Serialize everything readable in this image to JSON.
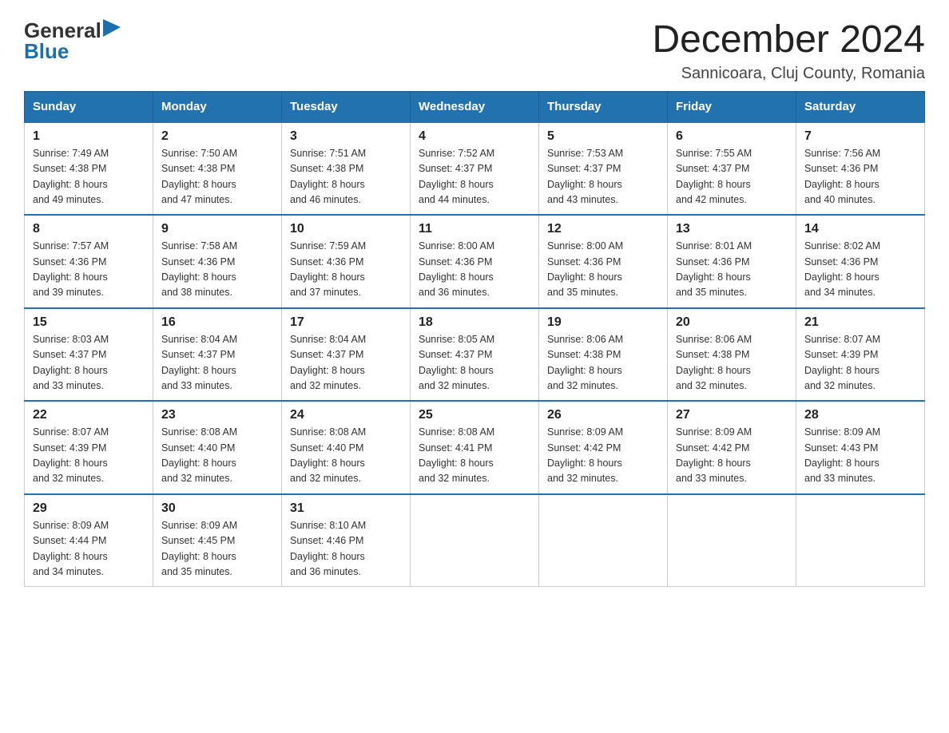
{
  "logo": {
    "general": "General",
    "blue": "Blue",
    "triangle": "▶"
  },
  "title": "December 2024",
  "location": "Sannicoara, Cluj County, Romania",
  "days_of_week": [
    "Sunday",
    "Monday",
    "Tuesday",
    "Wednesday",
    "Thursday",
    "Friday",
    "Saturday"
  ],
  "weeks": [
    [
      {
        "day": "1",
        "sunrise": "7:49 AM",
        "sunset": "4:38 PM",
        "daylight_hours": "8",
        "daylight_minutes": "49"
      },
      {
        "day": "2",
        "sunrise": "7:50 AM",
        "sunset": "4:38 PM",
        "daylight_hours": "8",
        "daylight_minutes": "47"
      },
      {
        "day": "3",
        "sunrise": "7:51 AM",
        "sunset": "4:38 PM",
        "daylight_hours": "8",
        "daylight_minutes": "46"
      },
      {
        "day": "4",
        "sunrise": "7:52 AM",
        "sunset": "4:37 PM",
        "daylight_hours": "8",
        "daylight_minutes": "44"
      },
      {
        "day": "5",
        "sunrise": "7:53 AM",
        "sunset": "4:37 PM",
        "daylight_hours": "8",
        "daylight_minutes": "43"
      },
      {
        "day": "6",
        "sunrise": "7:55 AM",
        "sunset": "4:37 PM",
        "daylight_hours": "8",
        "daylight_minutes": "42"
      },
      {
        "day": "7",
        "sunrise": "7:56 AM",
        "sunset": "4:36 PM",
        "daylight_hours": "8",
        "daylight_minutes": "40"
      }
    ],
    [
      {
        "day": "8",
        "sunrise": "7:57 AM",
        "sunset": "4:36 PM",
        "daylight_hours": "8",
        "daylight_minutes": "39"
      },
      {
        "day": "9",
        "sunrise": "7:58 AM",
        "sunset": "4:36 PM",
        "daylight_hours": "8",
        "daylight_minutes": "38"
      },
      {
        "day": "10",
        "sunrise": "7:59 AM",
        "sunset": "4:36 PM",
        "daylight_hours": "8",
        "daylight_minutes": "37"
      },
      {
        "day": "11",
        "sunrise": "8:00 AM",
        "sunset": "4:36 PM",
        "daylight_hours": "8",
        "daylight_minutes": "36"
      },
      {
        "day": "12",
        "sunrise": "8:00 AM",
        "sunset": "4:36 PM",
        "daylight_hours": "8",
        "daylight_minutes": "35"
      },
      {
        "day": "13",
        "sunrise": "8:01 AM",
        "sunset": "4:36 PM",
        "daylight_hours": "8",
        "daylight_minutes": "35"
      },
      {
        "day": "14",
        "sunrise": "8:02 AM",
        "sunset": "4:36 PM",
        "daylight_hours": "8",
        "daylight_minutes": "34"
      }
    ],
    [
      {
        "day": "15",
        "sunrise": "8:03 AM",
        "sunset": "4:37 PM",
        "daylight_hours": "8",
        "daylight_minutes": "33"
      },
      {
        "day": "16",
        "sunrise": "8:04 AM",
        "sunset": "4:37 PM",
        "daylight_hours": "8",
        "daylight_minutes": "33"
      },
      {
        "day": "17",
        "sunrise": "8:04 AM",
        "sunset": "4:37 PM",
        "daylight_hours": "8",
        "daylight_minutes": "32"
      },
      {
        "day": "18",
        "sunrise": "8:05 AM",
        "sunset": "4:37 PM",
        "daylight_hours": "8",
        "daylight_minutes": "32"
      },
      {
        "day": "19",
        "sunrise": "8:06 AM",
        "sunset": "4:38 PM",
        "daylight_hours": "8",
        "daylight_minutes": "32"
      },
      {
        "day": "20",
        "sunrise": "8:06 AM",
        "sunset": "4:38 PM",
        "daylight_hours": "8",
        "daylight_minutes": "32"
      },
      {
        "day": "21",
        "sunrise": "8:07 AM",
        "sunset": "4:39 PM",
        "daylight_hours": "8",
        "daylight_minutes": "32"
      }
    ],
    [
      {
        "day": "22",
        "sunrise": "8:07 AM",
        "sunset": "4:39 PM",
        "daylight_hours": "8",
        "daylight_minutes": "32"
      },
      {
        "day": "23",
        "sunrise": "8:08 AM",
        "sunset": "4:40 PM",
        "daylight_hours": "8",
        "daylight_minutes": "32"
      },
      {
        "day": "24",
        "sunrise": "8:08 AM",
        "sunset": "4:40 PM",
        "daylight_hours": "8",
        "daylight_minutes": "32"
      },
      {
        "day": "25",
        "sunrise": "8:08 AM",
        "sunset": "4:41 PM",
        "daylight_hours": "8",
        "daylight_minutes": "32"
      },
      {
        "day": "26",
        "sunrise": "8:09 AM",
        "sunset": "4:42 PM",
        "daylight_hours": "8",
        "daylight_minutes": "32"
      },
      {
        "day": "27",
        "sunrise": "8:09 AM",
        "sunset": "4:42 PM",
        "daylight_hours": "8",
        "daylight_minutes": "33"
      },
      {
        "day": "28",
        "sunrise": "8:09 AM",
        "sunset": "4:43 PM",
        "daylight_hours": "8",
        "daylight_minutes": "33"
      }
    ],
    [
      {
        "day": "29",
        "sunrise": "8:09 AM",
        "sunset": "4:44 PM",
        "daylight_hours": "8",
        "daylight_minutes": "34"
      },
      {
        "day": "30",
        "sunrise": "8:09 AM",
        "sunset": "4:45 PM",
        "daylight_hours": "8",
        "daylight_minutes": "35"
      },
      {
        "day": "31",
        "sunrise": "8:10 AM",
        "sunset": "4:46 PM",
        "daylight_hours": "8",
        "daylight_minutes": "36"
      },
      null,
      null,
      null,
      null
    ]
  ]
}
